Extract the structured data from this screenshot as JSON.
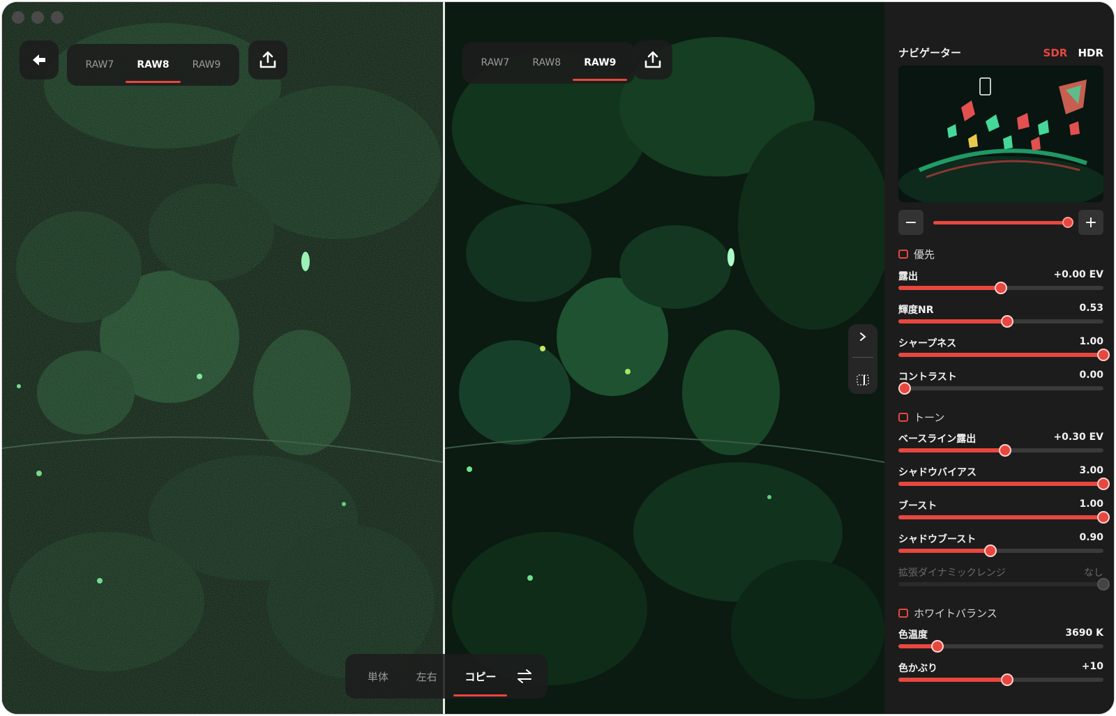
{
  "left_pane": {
    "tabs": [
      {
        "label": "RAW7",
        "active": false
      },
      {
        "label": "RAW8",
        "active": true
      },
      {
        "label": "RAW9",
        "active": false
      }
    ]
  },
  "right_pane": {
    "tabs": [
      {
        "label": "RAW7",
        "active": false
      },
      {
        "label": "RAW8",
        "active": false
      },
      {
        "label": "RAW9",
        "active": true
      }
    ]
  },
  "bottom_bar": {
    "modes": [
      {
        "label": "単体",
        "active": false
      },
      {
        "label": "左右",
        "active": false
      },
      {
        "label": "コピー",
        "active": true
      }
    ]
  },
  "navigator": {
    "title": "ナビゲーター",
    "sdr": "SDR",
    "hdr": "HDR",
    "zoom_minus": "−",
    "zoom_plus": "+",
    "zoom_level": 1.0
  },
  "sections": {
    "priority": "優先",
    "tone": "トーン",
    "white_balance": "ホワイトバランス"
  },
  "sliders": {
    "exposure": {
      "label": "露出",
      "value": "+0.00 EV",
      "fraction": 0.5
    },
    "luma_nr": {
      "label": "輝度NR",
      "value": "0.53",
      "fraction": 0.53
    },
    "sharpness": {
      "label": "シャープネス",
      "value": "1.00",
      "fraction": 1.0
    },
    "contrast": {
      "label": "コントラスト",
      "value": "0.00",
      "fraction": 0.03
    },
    "baseline_exposure": {
      "label": "ベースライン露出",
      "value": "+0.30 EV",
      "fraction": 0.52
    },
    "shadow_bias": {
      "label": "シャドウバイアス",
      "value": "3.00",
      "fraction": 1.0
    },
    "boost": {
      "label": "ブースト",
      "value": "1.00",
      "fraction": 1.0
    },
    "shadow_boost": {
      "label": "シャドウブースト",
      "value": "0.90",
      "fraction": 0.45
    },
    "extended_dr": {
      "label": "拡張ダイナミックレンジ",
      "value": "なし",
      "fraction": 1.0
    },
    "color_temp": {
      "label": "色温度",
      "value": "3690 K",
      "fraction": 0.19
    },
    "tint": {
      "label": "色かぶり",
      "value": "+10",
      "fraction": 0.53
    }
  },
  "colors": {
    "accent": "#e8473f",
    "panel_bg": "#1c1c1c"
  }
}
